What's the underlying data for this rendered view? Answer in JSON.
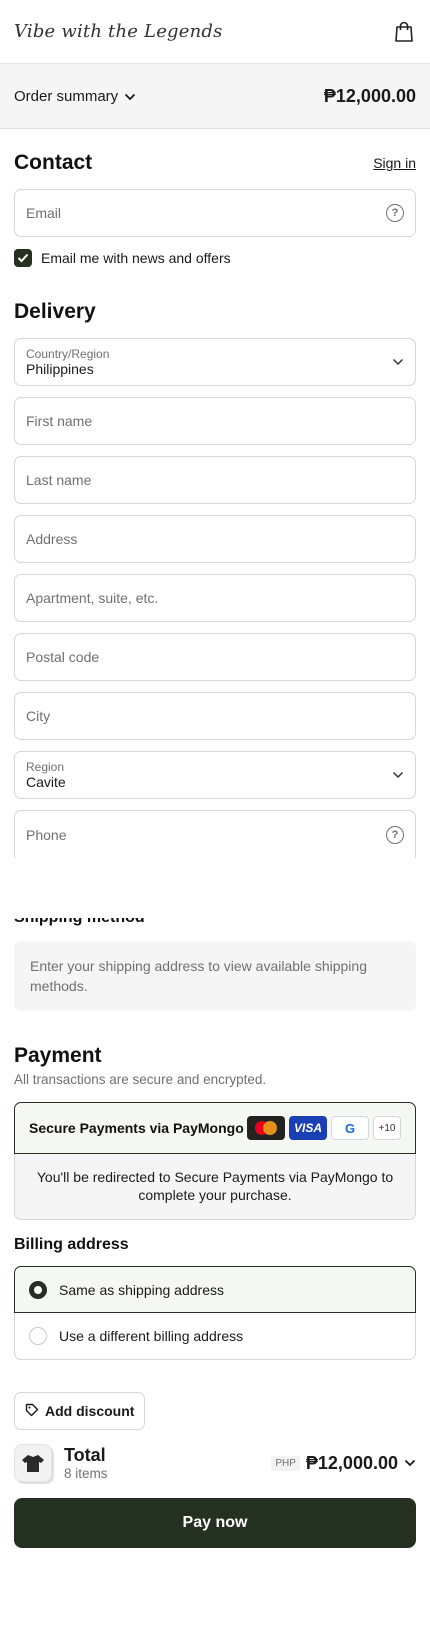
{
  "header": {
    "logo": "Vibe with the Legends",
    "cart_icon": "shopping-bag-icon"
  },
  "order_summary": {
    "label": "Order summary",
    "total": "₱12,000.00"
  },
  "contact": {
    "title": "Contact",
    "sign_in": "Sign in",
    "email_placeholder": "Email",
    "newsletter_label": "Email me with news and offers",
    "newsletter_checked": true
  },
  "delivery": {
    "title": "Delivery",
    "country_label": "Country/Region",
    "country_value": "Philippines",
    "first_name_placeholder": "First name",
    "last_name_placeholder": "Last name",
    "address_placeholder": "Address",
    "apartment_placeholder": "Apartment, suite, etc.",
    "postal_placeholder": "Postal code",
    "city_placeholder": "City",
    "region_label": "Region",
    "region_value": "Cavite",
    "phone_placeholder": "Phone"
  },
  "shipping": {
    "title": "Shipping method",
    "note": "Enter your shipping address to view available shipping methods."
  },
  "payment": {
    "title": "Payment",
    "subtitle": "All transactions are secure and encrypted.",
    "method_label": "Secure Payments via PayMongo",
    "cards": [
      "mastercard",
      "VISA",
      "G",
      "+10"
    ],
    "redirect_note": "You'll be redirected to Secure Payments via PayMongo to complete your purchase."
  },
  "billing": {
    "title": "Billing address",
    "option_same": "Same as shipping address",
    "option_different": "Use a different billing address"
  },
  "discount": {
    "label": "Add discount"
  },
  "total": {
    "label": "Total",
    "items": "8 items",
    "currency": "PHP",
    "amount": "₱12,000.00"
  },
  "pay_button": "Pay now",
  "colors": {
    "accent": "#243020",
    "muted": "#707070",
    "border": "#d6d6d6"
  }
}
